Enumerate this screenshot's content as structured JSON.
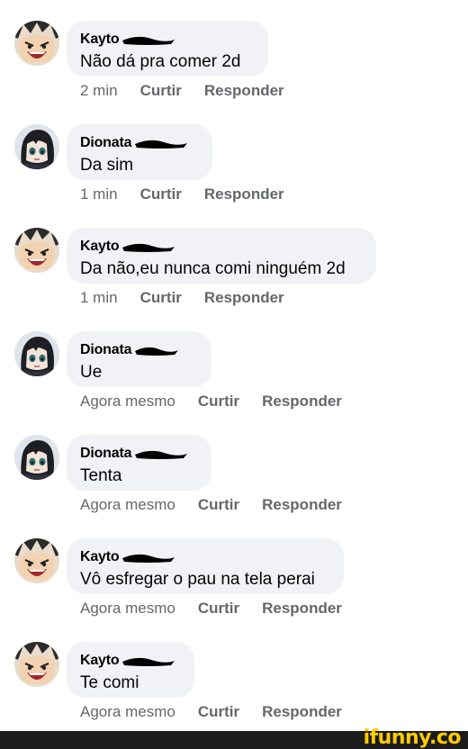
{
  "actions": {
    "like_label": "Curtir",
    "reply_label": "Responder"
  },
  "comments": [
    {
      "author": "Kayto",
      "avatar": "anime-screaming-avatar",
      "text": "Não dá pra comer 2d",
      "time": "2 min"
    },
    {
      "author": "Dionata",
      "avatar": "anime-dark-hair-avatar",
      "text": "Da sim",
      "time": "1 min"
    },
    {
      "author": "Kayto",
      "avatar": "anime-screaming-avatar",
      "text": "Da não,eu nunca comi ninguém 2d",
      "time": "1 min"
    },
    {
      "author": "Dionata",
      "avatar": "anime-dark-hair-avatar",
      "text": "Ue",
      "time": "Agora mesmo"
    },
    {
      "author": "Dionata",
      "avatar": "anime-dark-hair-avatar",
      "text": "Tenta",
      "time": "Agora mesmo"
    },
    {
      "author": "Kayto",
      "avatar": "anime-screaming-avatar",
      "text": "Vô esfregar o pau na tela perai",
      "time": "Agora mesmo"
    },
    {
      "author": "Kayto",
      "avatar": "anime-screaming-avatar",
      "text": "Te comi",
      "time": "Agora mesmo"
    }
  ],
  "watermark": "ifunny.co",
  "colors": {
    "bubble": "#f0f2f5",
    "meta_text": "#65676b",
    "body_text": "#050505",
    "redaction": "#000000",
    "watermark": "#ffcc00",
    "footer_bar": "#1c1c1c"
  }
}
